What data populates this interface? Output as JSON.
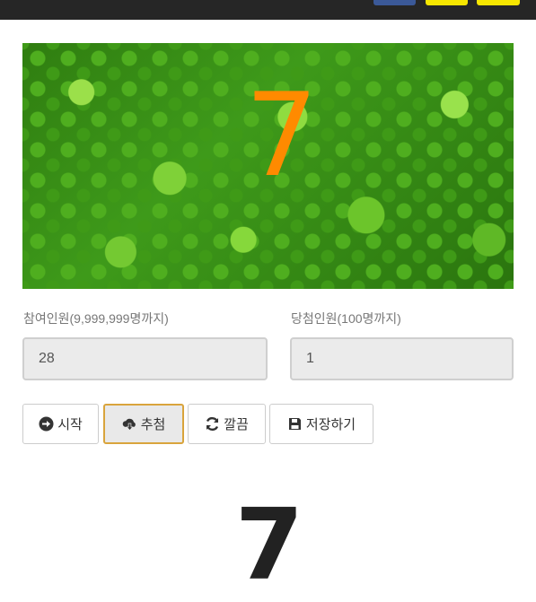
{
  "header": {
    "share_buttons": [
      "facebook-share-icon",
      "kakaostory-share-icon",
      "kakaotalk-share-icon"
    ],
    "colors": {
      "bar": "#262626",
      "facebook": "#3b5998",
      "kakao": "#f7e600"
    }
  },
  "banner": {
    "drawn_number": "7",
    "number_color": "#ff8a00"
  },
  "form": {
    "participants_label": "참여인원(9,999,999명까지)",
    "participants_value": "28",
    "winners_label": "당첨인원(100명까지)",
    "winners_value": "1"
  },
  "buttons": {
    "start": {
      "label": "시작",
      "icon": "arrow-circle-right-icon"
    },
    "draw": {
      "label": "추첨",
      "icon": "cloud-download-icon"
    },
    "reset": {
      "label": "깔끔",
      "icon": "refresh-icon"
    },
    "save": {
      "label": "저장하기",
      "icon": "floppy-disk-icon"
    }
  },
  "result": {
    "number": "7"
  }
}
